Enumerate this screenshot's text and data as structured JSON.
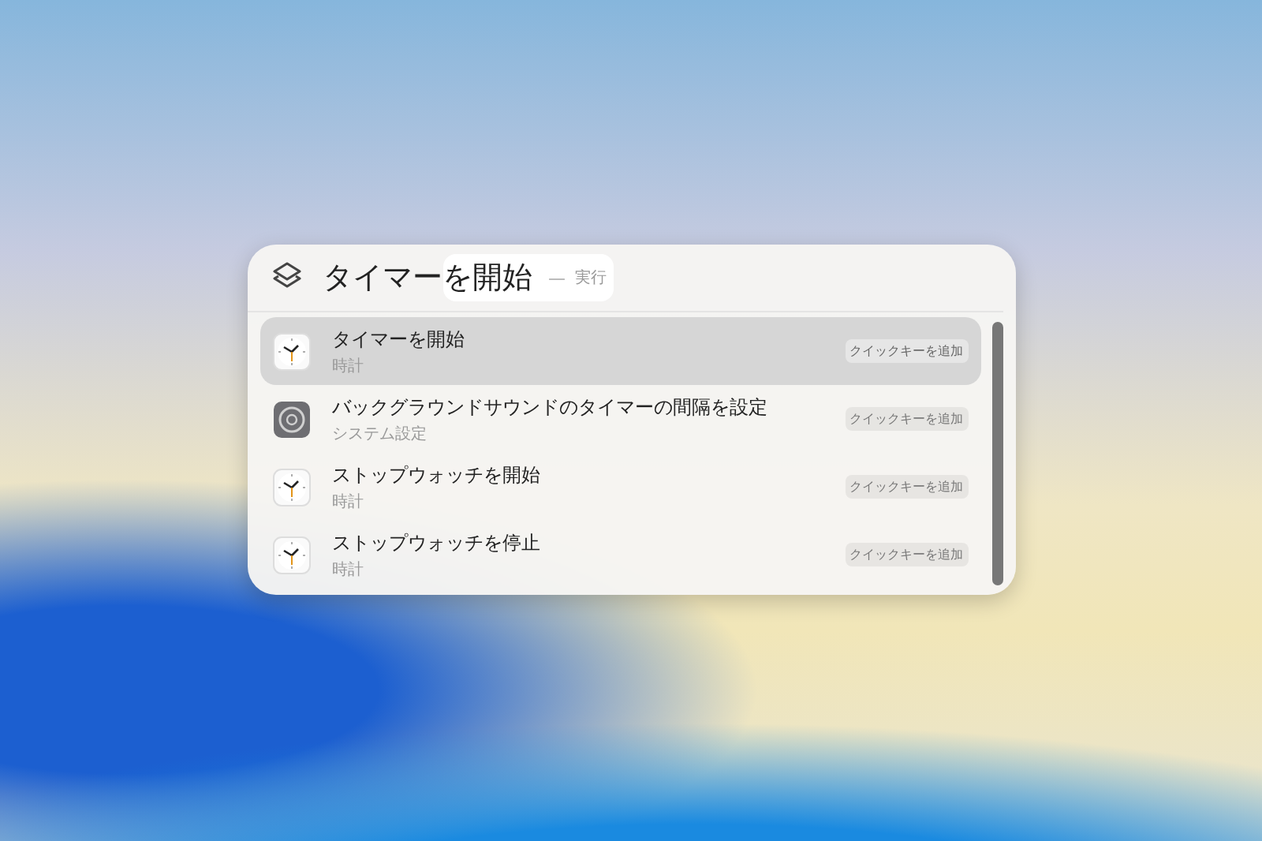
{
  "search": {
    "typed": "タイマー",
    "completion": "を開始",
    "separator": "—",
    "action": "実行"
  },
  "results": [
    {
      "title": "タイマーを開始",
      "subtitle": "時計",
      "kind": "clock",
      "shortcut": "クイックキーを追加",
      "selected": true
    },
    {
      "title": "バックグラウンドサウンドのタイマーの間隔を設定",
      "subtitle": "システム設定",
      "kind": "settings",
      "shortcut": "クイックキーを追加",
      "selected": false
    },
    {
      "title": "ストップウォッチを開始",
      "subtitle": "時計",
      "kind": "clock",
      "shortcut": "クイックキーを追加",
      "selected": false
    },
    {
      "title": "ストップウォッチを停止",
      "subtitle": "時計",
      "kind": "clock",
      "shortcut": "クイックキーを追加",
      "selected": false
    }
  ]
}
